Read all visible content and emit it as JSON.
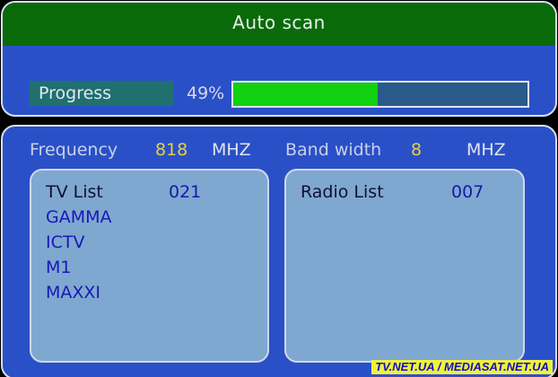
{
  "title": "Auto scan",
  "progress": {
    "label": "Progress",
    "percent_text": "49%",
    "value": 0.49,
    "fill_color": "#10d010",
    "track_color": "#2a5a8a"
  },
  "frequency": {
    "label": "Frequency",
    "value": "818",
    "unit": "MHZ"
  },
  "bandwidth": {
    "label": "Band width",
    "value": "8",
    "unit": "MHZ"
  },
  "tv_list": {
    "label": "TV List",
    "count": "021",
    "channels": [
      "GAMMA",
      "ICTV",
      "M1",
      "MAXXI"
    ]
  },
  "radio_list": {
    "label": "Radio List",
    "count": "007",
    "channels": []
  },
  "watermark": "TV.NET.UA / MEDIASAT.NET.UA",
  "colors": {
    "title_bar": "#0a6a0a",
    "panel": "#2a50c8",
    "list_box": "#7fa8d0",
    "value_highlight": "#e8d040"
  }
}
